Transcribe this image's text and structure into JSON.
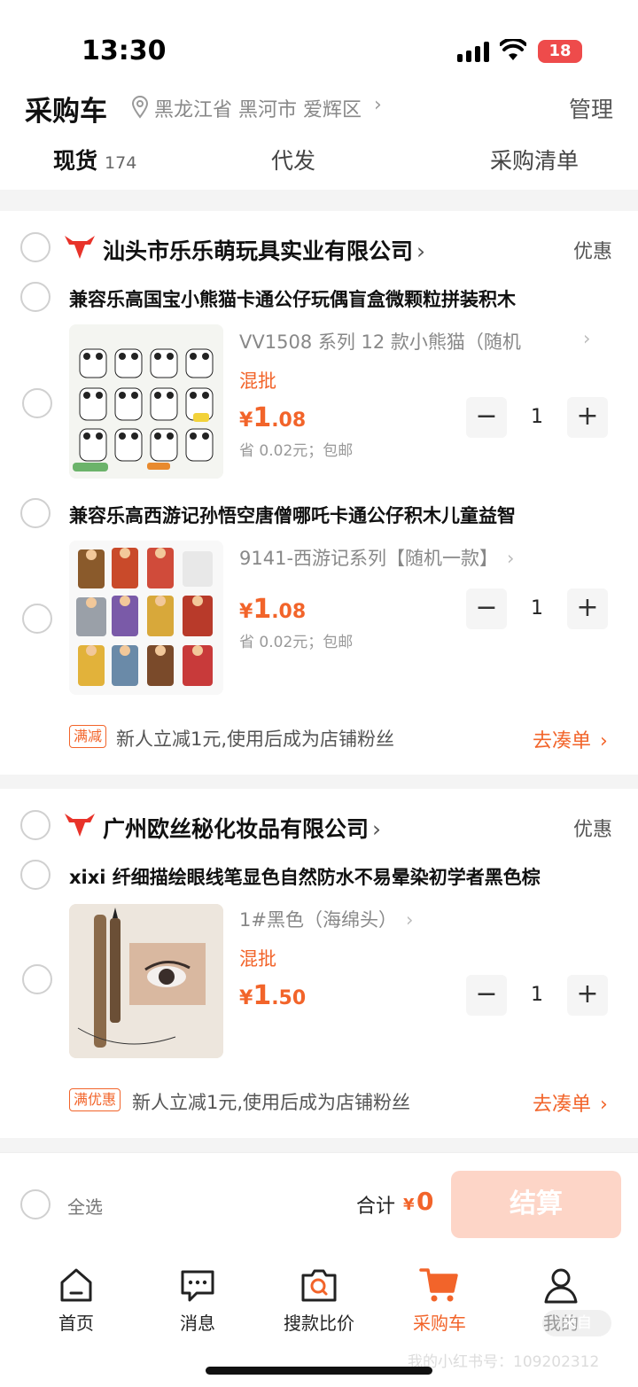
{
  "status_bar": {
    "time": "13:30",
    "battery": "18"
  },
  "header": {
    "title": "采购车",
    "location": "黑龙江省 黑河市 爱辉区",
    "manage_label": "管理",
    "tabs": [
      {
        "label": "现货",
        "count": "174"
      },
      {
        "label": "代发"
      },
      {
        "label": "采购清单"
      }
    ]
  },
  "shops": [
    {
      "name": "汕头市乐乐萌玩具实业有限公司",
      "promo_label": "优惠",
      "products": [
        {
          "title": "兼容乐高国宝小熊猫卡通公仔玩偶盲盒微颗粒拼装积木",
          "variant": "VV1508 系列 12 款小熊猫（随机",
          "mix_label": "混批",
          "price_int": "1",
          "price_dec": ".08",
          "saving": "省 0.02元；包邮",
          "quantity": "1"
        },
        {
          "title": "兼容乐高西游记孙悟空唐僧哪吒卡通公仔积木儿童益智",
          "variant": "9141-西游记系列【随机一款】",
          "mix_label": "",
          "price_int": "1",
          "price_dec": ".08",
          "saving": "省 0.02元；包邮",
          "quantity": "1"
        }
      ],
      "coupon": {
        "tag": "满减",
        "text": "新人立减1元,使用后成为店铺粉丝",
        "action": "去凑单"
      }
    },
    {
      "name": "广州欧丝秘化妆品有限公司",
      "promo_label": "优惠",
      "products": [
        {
          "title": "xixi 纤细描绘眼线笔显色自然防水不易晕染初学者黑色棕",
          "variant": "1#黑色（海绵头）",
          "mix_label": "混批",
          "price_int": "1",
          "price_dec": ".50",
          "saving": "",
          "quantity": "1"
        }
      ],
      "coupon": {
        "tag": "满优惠",
        "text": "新人立减1元,使用后成为店铺粉丝",
        "action": "去凑单"
      }
    }
  ],
  "checkout": {
    "select_all": "全选",
    "total_label": "合计",
    "currency": "¥",
    "total": "0",
    "button": "结算"
  },
  "nav": [
    {
      "label": "首页",
      "icon": "home-icon"
    },
    {
      "label": "消息",
      "icon": "message-icon"
    },
    {
      "label": "搜款比价",
      "icon": "search-compare-icon"
    },
    {
      "label": "采购车",
      "icon": "cart-icon",
      "active": true
    },
    {
      "label": "我的",
      "icon": "profile-icon"
    }
  ],
  "watermark": {
    "id_text": "我的小红书号：109202312",
    "badge": "来自"
  },
  "colors": {
    "accent": "#f2642a",
    "checkout_button": "#fdd5c7"
  }
}
